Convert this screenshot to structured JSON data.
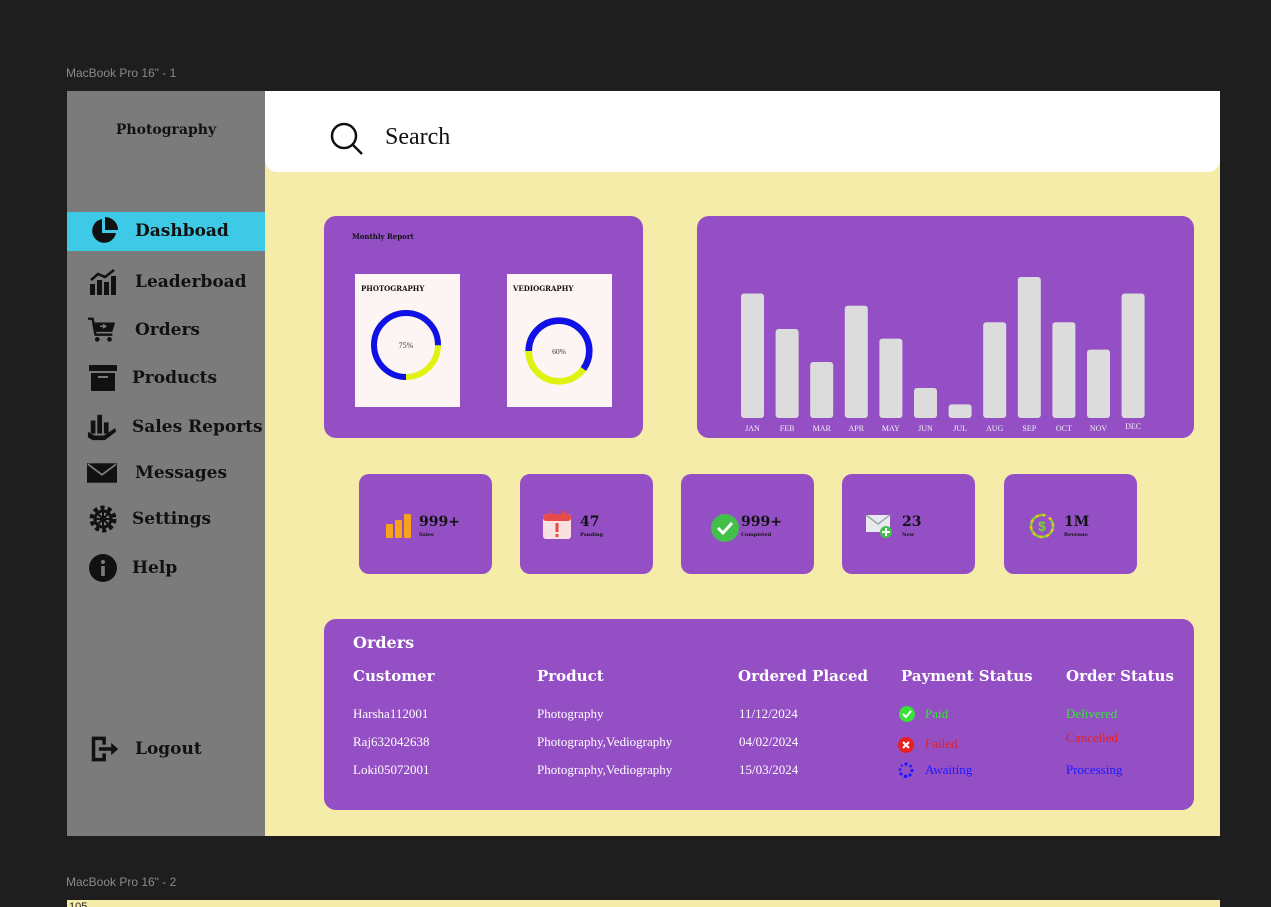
{
  "frames": {
    "frame1": "MacBook Pro 16\" - 1",
    "frame2": "MacBook Pro 16\" - 2",
    "frame2_corner_text": "105"
  },
  "brand": "Photography",
  "sidebar": {
    "items": [
      {
        "label": "Dashboad",
        "icon": "pie-chart-icon",
        "active": true
      },
      {
        "label": "Leaderboad",
        "icon": "growth-chart-icon"
      },
      {
        "label": "Orders",
        "icon": "cart-icon"
      },
      {
        "label": "Products",
        "icon": "archive-box-icon"
      },
      {
        "label": "Sales Reports",
        "icon": "hand-chart-icon"
      },
      {
        "label": "Messages",
        "icon": "envelope-icon"
      },
      {
        "label": "Settings",
        "icon": "gear-icon"
      },
      {
        "label": "Help",
        "icon": "info-icon"
      }
    ],
    "logout": "Logout"
  },
  "search": {
    "placeholder": "Search"
  },
  "monthly_report": {
    "title": "Monthly Report",
    "photography": {
      "title": "PHOTOGRAPHY",
      "percent": 75,
      "label": "75%"
    },
    "vediography": {
      "title": "VEDIOGRAPHY",
      "percent": 60,
      "label": "60%"
    }
  },
  "chart_data": {
    "type": "bar",
    "categories": [
      "JAN",
      "FEB",
      "MAR",
      "APR",
      "MAY",
      "JUN",
      "JUL",
      "AUG",
      "SEP",
      "OCT",
      "NOV",
      "DEC"
    ],
    "values": [
      88,
      62,
      38,
      79,
      55,
      19,
      7,
      67,
      100,
      67,
      47,
      88
    ],
    "ylim": [
      0,
      100
    ],
    "title": "",
    "xlabel": "",
    "ylabel": ""
  },
  "stats": [
    {
      "value": "999+",
      "caption": "Sales",
      "icon": "bar-chart-icon"
    },
    {
      "value": "47",
      "caption": "Panding",
      "icon": "calendar-alert-icon"
    },
    {
      "value": "999+",
      "caption": "Completed",
      "icon": "check-circle-icon"
    },
    {
      "value": "23",
      "caption": "New",
      "icon": "mail-add-icon"
    },
    {
      "value": "1M",
      "caption": "Revenue",
      "icon": "revenue-icon"
    }
  ],
  "orders": {
    "title": "Orders",
    "columns": [
      "Customer",
      "Product",
      "Ordered Placed",
      "Payment Status",
      "Order Status"
    ],
    "rows": [
      {
        "customer": "Harsha112001",
        "product": "Photography",
        "date": "11/12/2024",
        "payment": "Paid",
        "status": "Delivered"
      },
      {
        "customer": "Raj632042638",
        "product": "Photography,Vediography",
        "date": "04/02/2024",
        "payment": "Failed",
        "status": "Cancelled"
      },
      {
        "customer": "Loki05072001",
        "product": "Photography,Vediography",
        "date": "15/03/2024",
        "payment": "Awaiting",
        "status": "Processing"
      }
    ]
  },
  "colors": {
    "card": "#944fc5",
    "page": "#f4eca8",
    "sidebar": "#7b7b7b",
    "active": "#3ec9e6",
    "bar": "#dcdcdc",
    "ring_primary": "#1010e8",
    "ring_secondary": "#e0f20f",
    "paid": "#3be03b",
    "failed": "#e82020",
    "awaiting": "#1a1aff"
  }
}
